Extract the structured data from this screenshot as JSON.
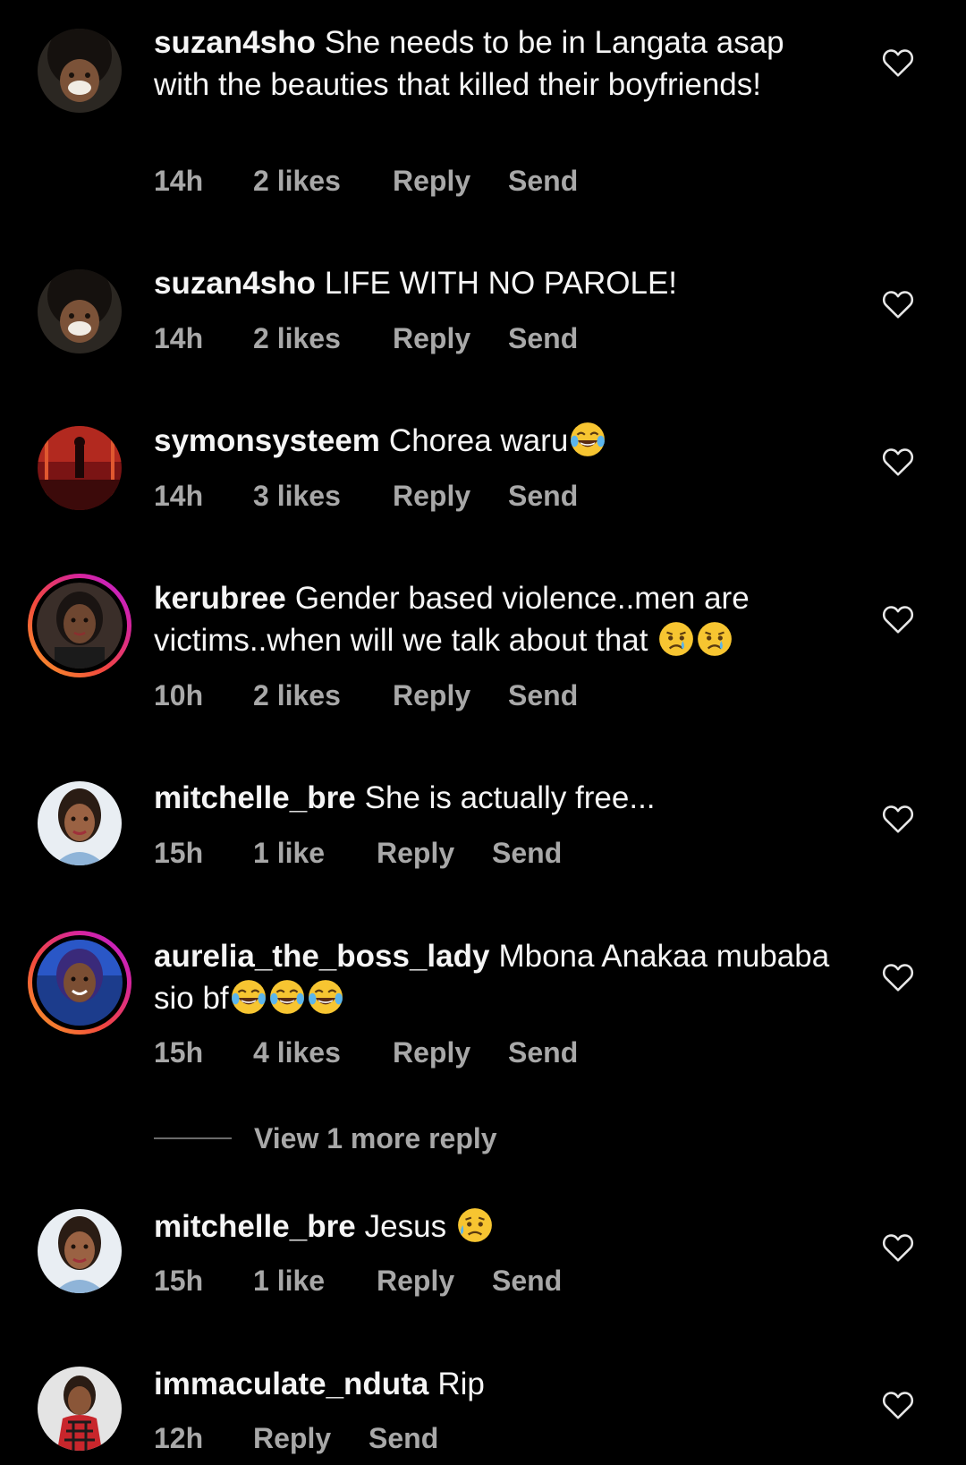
{
  "colors": {
    "background": "#000000",
    "text": "#f5f5f5",
    "meta": "#a8a8a8",
    "story_ring_start": "#f9a325",
    "story_ring_end": "#b620e0"
  },
  "comments": [
    {
      "username": "suzan4sho",
      "text": "She needs to be in Langata asap with the beauties that killed their boyfriends!",
      "time": "14h",
      "likes": "2 likes",
      "reply": "Reply",
      "send": "Send",
      "avatar_icon": "child-avatar-icon",
      "like_icon": "heart-outline-icon"
    },
    {
      "username": "suzan4sho",
      "text": "LIFE WITH NO PAROLE!",
      "time": "14h",
      "likes": "2 likes",
      "reply": "Reply",
      "send": "Send",
      "avatar_icon": "child-avatar-icon",
      "like_icon": "heart-outline-icon"
    },
    {
      "username": "symonsysteem",
      "text": "Chorea waru",
      "emojis": [
        "face-with-tears-of-joy-emoji"
      ],
      "time": "14h",
      "likes": "3 likes",
      "reply": "Reply",
      "send": "Send",
      "avatar_icon": "red-stage-avatar-icon",
      "like_icon": "heart-outline-icon"
    },
    {
      "username": "kerubree",
      "text": "Gender based violence..men are victims..when will we talk about that",
      "emojis": [
        "crying-face-emoji",
        "crying-face-emoji"
      ],
      "time": "10h",
      "likes": "2 likes",
      "reply": "Reply",
      "send": "Send",
      "has_story": true,
      "avatar_icon": "woman-avatar-icon",
      "like_icon": "heart-outline-icon"
    },
    {
      "username": "mitchelle_bre",
      "text": "She is actually free...",
      "time": "15h",
      "likes": "1 like",
      "reply": "Reply",
      "send": "Send",
      "avatar_icon": "woman-avatar-icon",
      "like_icon": "heart-outline-icon"
    },
    {
      "username": "aurelia_the_boss_lady",
      "text": "Mbona Anakaa mubaba sio bf",
      "emojis": [
        "face-with-tears-of-joy-emoji",
        "face-with-tears-of-joy-emoji",
        "face-with-tears-of-joy-emoji"
      ],
      "time": "15h",
      "likes": "4 likes",
      "reply": "Reply",
      "send": "Send",
      "has_story": true,
      "avatar_icon": "woman-avatar-icon",
      "like_icon": "heart-outline-icon"
    },
    {
      "username": "mitchelle_bre",
      "text": "Jesus",
      "emojis": [
        "sad-but-relieved-face-emoji"
      ],
      "time": "15h",
      "likes": "1 like",
      "reply": "Reply",
      "send": "Send",
      "avatar_icon": "woman-avatar-icon",
      "like_icon": "heart-outline-icon"
    },
    {
      "username": "immaculate_nduta",
      "text": "Rip",
      "time": "12h",
      "likes": "",
      "reply": "Reply",
      "send": "Send",
      "avatar_icon": "woman-avatar-icon",
      "like_icon": "heart-outline-icon"
    }
  ],
  "view_more_replies": "View 1 more reply"
}
